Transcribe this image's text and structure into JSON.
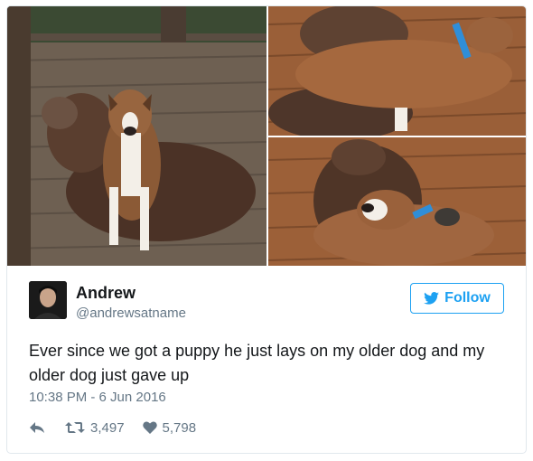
{
  "photos": {
    "main_alt": "",
    "top_right_alt": "",
    "bottom_right_alt": ""
  },
  "user": {
    "name": "Andrew",
    "handle": "@andrewsatname"
  },
  "follow_button": {
    "label": "Follow",
    "icon": "twitter-bird-icon"
  },
  "tweet": {
    "text": "Ever since we got a puppy he just lays on my older dog and my older dog just gave up",
    "timestamp": "10:38 PM - 6 Jun 2016"
  },
  "actions": {
    "reply_icon": "reply-icon",
    "retweet_icon": "retweet-icon",
    "retweet_count": "3,497",
    "like_icon": "heart-icon",
    "like_count": "5,798"
  },
  "colors": {
    "accent": "#1da1f2",
    "secondary_text": "#657786",
    "primary_text": "#14171a",
    "border": "#e1e8ed"
  }
}
